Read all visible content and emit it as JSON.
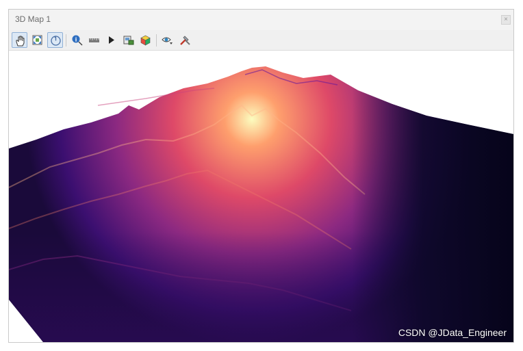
{
  "window": {
    "title": "3D Map 1",
    "close_label": "×"
  },
  "toolbar": {
    "tools": [
      {
        "name": "pan-hand-icon",
        "active": true
      },
      {
        "name": "zoom-full-icon",
        "active": false
      },
      {
        "name": "camera-rotate-icon",
        "active": true
      },
      {
        "name": "identify-icon",
        "active": false
      },
      {
        "name": "measure-icon",
        "active": false
      },
      {
        "name": "play-animation-icon",
        "active": false
      },
      {
        "name": "export-image-icon",
        "active": false
      },
      {
        "name": "export-3d-scene-icon",
        "active": false
      },
      {
        "name": "camera-view-icon",
        "active": false
      },
      {
        "name": "configure-icon",
        "active": false
      }
    ]
  },
  "scene": {
    "colormap": [
      "#0d0829",
      "#3b0f70",
      "#8c2981",
      "#de4968",
      "#fe9f6d",
      "#fcfdbf"
    ]
  },
  "watermark": "CSDN @JData_Engineer"
}
